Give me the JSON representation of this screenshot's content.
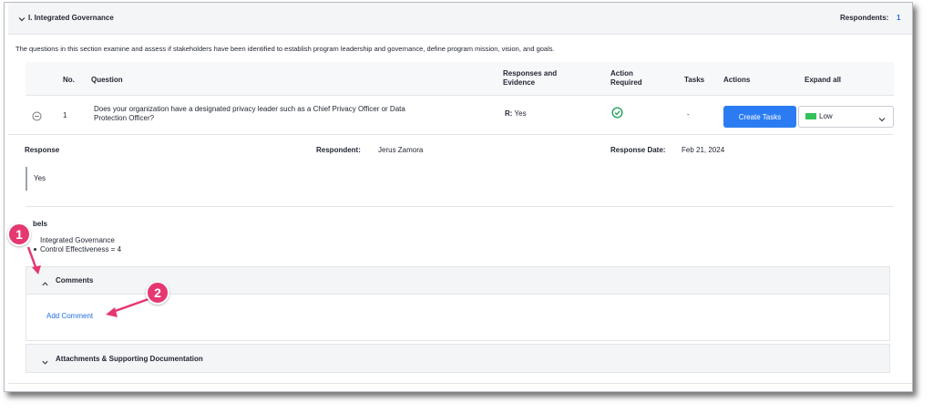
{
  "section": {
    "title": "I. Integrated Governance",
    "respondents_label": "Respondents:",
    "respondents_count": "1",
    "description": "The questions in this section examine and assess if stakeholders have been identified to establish program leadership and governance, define program mission, vision, and goals."
  },
  "table": {
    "headers": {
      "no": "No.",
      "question": "Question",
      "responses_line1": "Responses and",
      "responses_line2": "Evidence",
      "action_line1": "Action",
      "action_line2": "Required",
      "tasks": "Tasks",
      "actions": "Actions",
      "expand_all": "Expand all"
    },
    "row": {
      "no": "1",
      "question_line1": "Does your organization have a designated privacy leader such as a Chief Privacy Officer or Data",
      "question_line2": "Protection Officer?",
      "response_prefix": "R:",
      "response_value": "Yes",
      "tasks": "-",
      "create_tasks_label": "Create Tasks",
      "priority_value": "Low"
    }
  },
  "detail": {
    "response_label": "Response",
    "response_value": "Yes",
    "respondent_label": "Respondent:",
    "respondent_name": "Jerus Zamora",
    "response_date_label": "Response Date:",
    "response_date": "Feb 21, 2024",
    "labels_heading": "bels",
    "labels": [
      "Integrated Governance",
      "Control Effectiveness = 4"
    ]
  },
  "comments": {
    "title": "Comments",
    "add_comment_label": "Add Comment"
  },
  "attachments": {
    "title": "Attachments & Supporting Documentation"
  },
  "annotations": {
    "marker1": "1",
    "marker2": "2"
  },
  "colors": {
    "accent": "#2b7cf3",
    "marker": "#e53870",
    "priority_low": "#34c25c",
    "check": "#22a35a"
  }
}
